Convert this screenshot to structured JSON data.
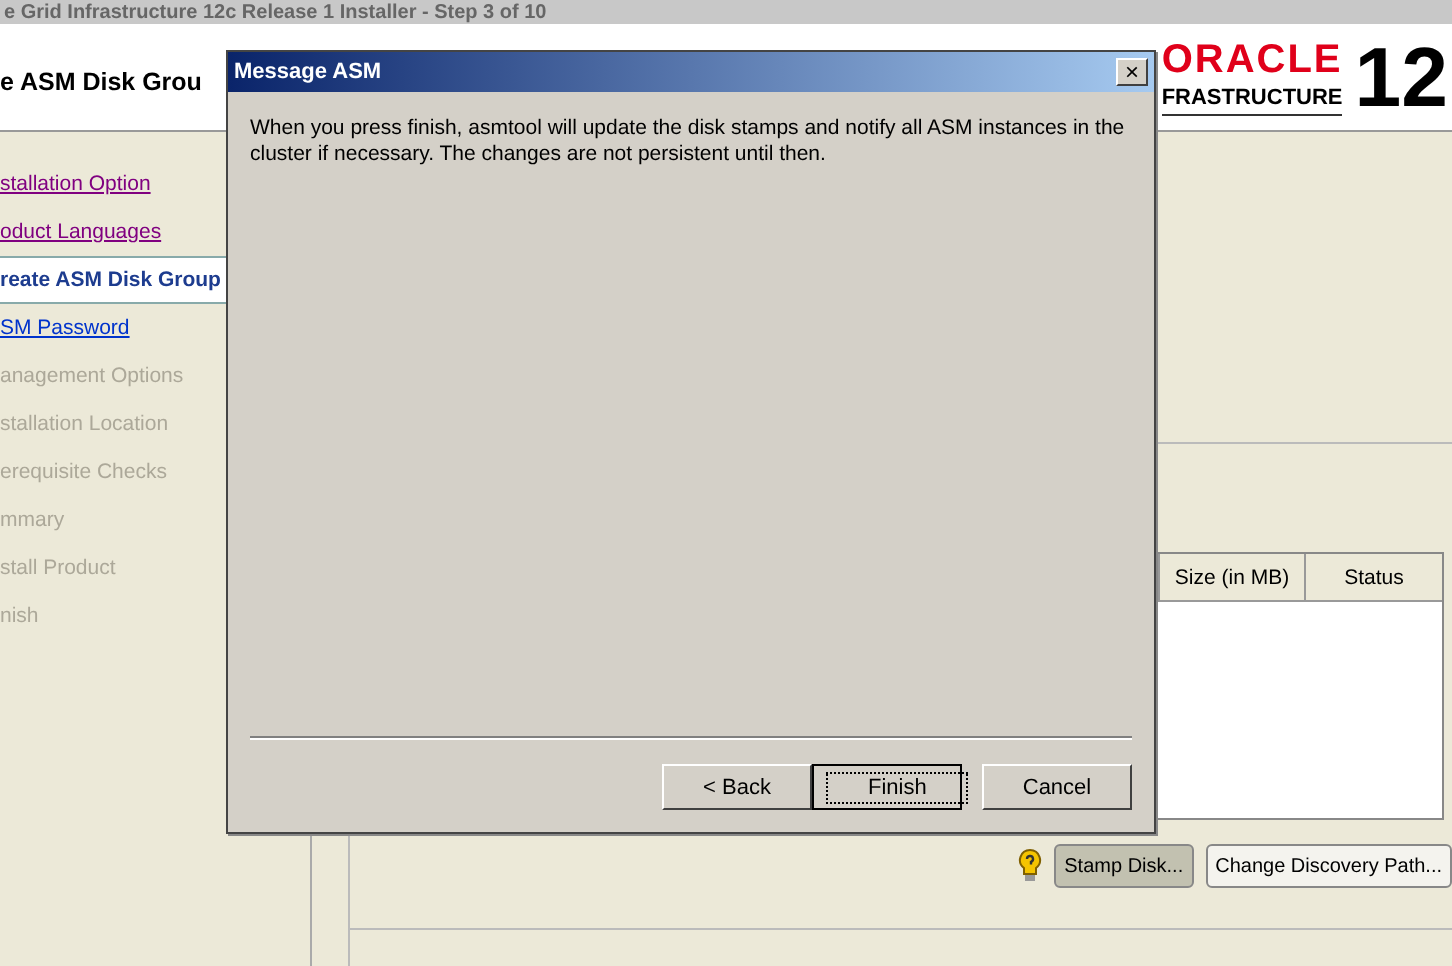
{
  "window": {
    "title": "e Grid Infrastructure 12c Release 1 Installer - Step 3 of 10"
  },
  "header": {
    "heading": "e ASM Disk Grou",
    "logo_brand": "ORACLE",
    "logo_product": "FRASTRUCTURE",
    "logo_version": "12"
  },
  "sidebar": {
    "items": [
      {
        "label": "stallation Option",
        "kind": "visited"
      },
      {
        "label": "oduct Languages",
        "kind": "visited"
      },
      {
        "label": "reate ASM Disk Group",
        "kind": "current"
      },
      {
        "label": "SM Password",
        "kind": "link"
      },
      {
        "label": "anagement Options",
        "kind": "disabled"
      },
      {
        "label": "stallation Location",
        "kind": "disabled"
      },
      {
        "label": "erequisite Checks",
        "kind": "disabled"
      },
      {
        "label": "mmary",
        "kind": "disabled"
      },
      {
        "label": "stall Product",
        "kind": "disabled"
      },
      {
        "label": "nish",
        "kind": "disabled"
      }
    ]
  },
  "table": {
    "columns": [
      "Size (in MB)",
      "Status"
    ]
  },
  "buttons": [
    {
      "label": "Stamp Disk...",
      "kind": "pressed"
    },
    {
      "label": "Change Discovery Path...",
      "kind": "normal"
    }
  ],
  "dialog": {
    "title": "Message ASM",
    "close": "×",
    "message": "When you press finish, asmtool will update the disk stamps and notify all ASM instances in the cluster if necessary. The changes are not persistent until then.",
    "buttons": [
      {
        "label": "< Back",
        "default": false
      },
      {
        "label": "Finish",
        "default": true
      },
      {
        "label": "Cancel",
        "default": false
      }
    ]
  }
}
